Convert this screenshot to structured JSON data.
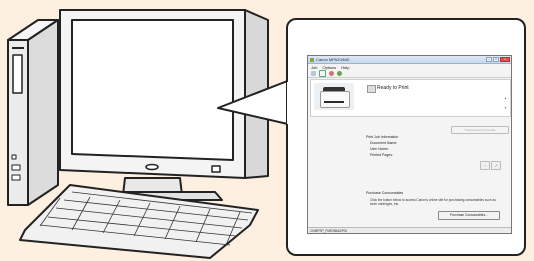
{
  "window": {
    "title": "Canon MP620/640",
    "menu": [
      "Job",
      "Options",
      "Help"
    ],
    "status": "Ready to Print",
    "troubleshoot_label": "Troubleshooting Details",
    "job_info": {
      "heading": "Print Job Information",
      "fields": [
        "Document Name:",
        "User Name:",
        "Printed Pages:"
      ]
    },
    "consumables": {
      "heading": "Purchase Consumables",
      "description": "Click the button below to access Canon's online site for purchasing consumables such as toner cartridges, etc.",
      "button_label": "Purchase Consumables..."
    },
    "statusbar_text": "CNMPSP_FME2B6A2F00"
  },
  "colors": {
    "background": "#fdf0e0",
    "frame_border": "#222222",
    "window_title": "#c6d8ee",
    "close_button": "#d9534f"
  },
  "icons": [
    "computer-tower-icon",
    "monitor-icon",
    "keyboard-icon",
    "printer-icon"
  ]
}
